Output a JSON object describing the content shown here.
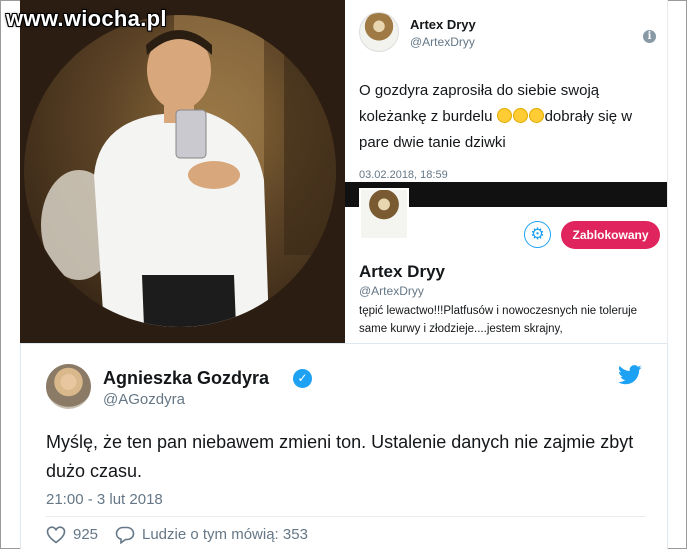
{
  "watermark": "www.wiocha.pl",
  "tweet_card": {
    "name": "Artex Dryy",
    "handle": "@ArtexDryy",
    "text_part1": "O gozdyra zaprosiła do siebie swoją koleżankę z burdelu ",
    "text_part2": "dobrały się w pare dwie tanie dziwki",
    "date": "03.02.2018, 18:59"
  },
  "profile_card": {
    "blocked_label": "Zablokowany",
    "name": "Artex Dryy",
    "handle": "@ArtexDryy",
    "bio": "tępić lewactwo!!!Platfusów i nowoczesnych nie toleruje same kurwy i złodzieje....jestem skrajny,"
  },
  "main_tweet": {
    "name": "Agnieszka Gozdyra",
    "handle": "@AGozdyra",
    "text": "Myślę, że ten pan niebawem zmieni ton. Ustalenie danych nie zajmie zbyt dużo czasu.",
    "time": "21:00 - 3 lut 2018",
    "likes": "925",
    "talking": "Ludzie o tym mówią: 353"
  },
  "colors": {
    "twitter_blue": "#1da1f2",
    "blocked_red": "#e0245e",
    "secondary_text": "#657786"
  }
}
